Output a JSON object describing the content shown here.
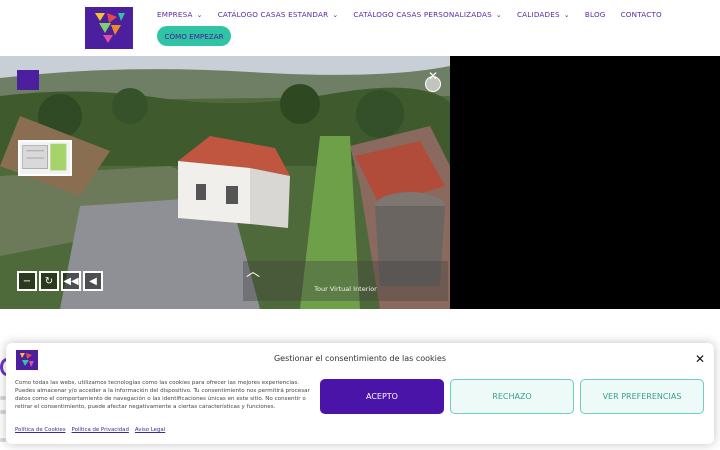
{
  "header": {
    "nav": [
      {
        "label": "EMPRESA",
        "dropdown": true
      },
      {
        "label": "CATÁLOGO CASAS ESTANDAR",
        "dropdown": true
      },
      {
        "label": "CATÁLOGO CASAS PERSONALIZADAS",
        "dropdown": true
      },
      {
        "label": "CALIDADES",
        "dropdown": true
      },
      {
        "label": "BLOG",
        "dropdown": false
      },
      {
        "label": "CONTACTO",
        "dropdown": false
      }
    ],
    "cta_label": "CÓMO EMPEZAR",
    "chevron": "⌄"
  },
  "viewer": {
    "tour_label": "Tour Virtual Interior",
    "controls": [
      {
        "icon": "minus-icon",
        "glyph": "−"
      },
      {
        "icon": "rotate-icon",
        "glyph": "↻"
      },
      {
        "icon": "rewind-icon",
        "glyph": "◀◀"
      },
      {
        "icon": "play-back-icon",
        "glyph": "◀"
      }
    ],
    "close_glyph": "✕",
    "up_glyph": "︿"
  },
  "cookie": {
    "title": "Gestionar el consentimiento de las cookies",
    "message": "Como todas las webs, utilizamos tecnologías como las cookies para ofrecer las mejores experiencias. Puedes almacenar y/o acceder a la información del dispositivo. Tu consentimiento nos permitirá procesar datos como el comportamiento de navegación o las identificaciones únicas en este sitio. No consentir o retirar el consentimiento, puede afectar negativamente a ciertas características y funciones.",
    "accept": "ACEPTO",
    "reject": "RECHAZO",
    "preferences": "VER PREFERENCIAS",
    "close_glyph": "✕",
    "links": [
      "Política de Cookies",
      "Política de Privacidad",
      "Aviso Legal"
    ]
  },
  "colors": {
    "brand_purple": "#4b1f9e",
    "nav_text": "#5a2aa0",
    "cta_green": "#2fc4a4",
    "accept_bg": "#4b14a8"
  }
}
